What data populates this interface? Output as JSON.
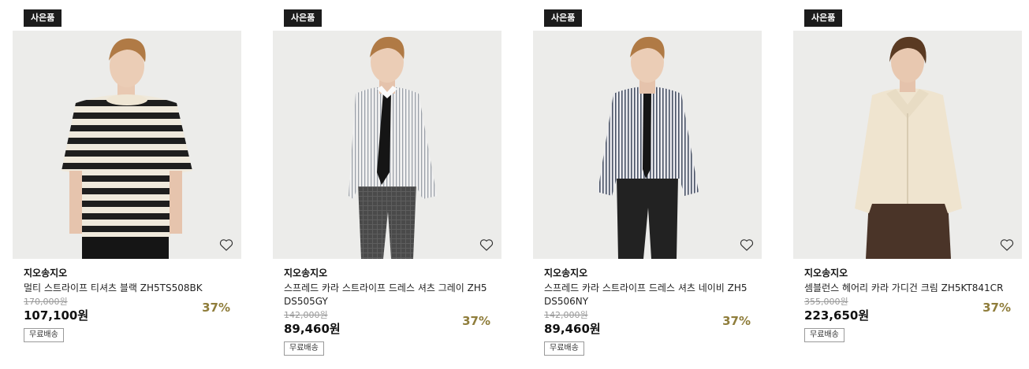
{
  "products": [
    {
      "badge": "사은품",
      "brand": "지오송지오",
      "name": "멀티 스트라이프 티셔츠 블랙 ZH5TS508BK",
      "original_price": "170,000원",
      "price": "107,100원",
      "discount": "37%",
      "shipping": "무료배송",
      "icon": "heart-icon"
    },
    {
      "badge": "사은품",
      "brand": "지오송지오",
      "name": "스프레드 카라 스트라이프 드레스 셔츠 그레이 ZH5DS505GY",
      "original_price": "142,000원",
      "price": "89,460원",
      "discount": "37%",
      "shipping": "무료배송",
      "icon": "heart-icon"
    },
    {
      "badge": "사은품",
      "brand": "지오송지오",
      "name": "스프레드 카라 스트라이프 드레스 셔츠 네이비 ZH5DS506NY",
      "original_price": "142,000원",
      "price": "89,460원",
      "discount": "37%",
      "shipping": "무료배송",
      "icon": "heart-icon"
    },
    {
      "badge": "사은품",
      "brand": "지오송지오",
      "name": "셈블런스 헤어리 카라 가디건 크림 ZH5KT841CR",
      "original_price": "355,000원",
      "price": "223,650원",
      "discount": "37%",
      "shipping": "무료배송",
      "icon": "heart-icon"
    }
  ],
  "colors": {
    "badge_bg": "#1c1c1c",
    "discount": "#8f7d3b",
    "image_bg": "#ececea"
  }
}
